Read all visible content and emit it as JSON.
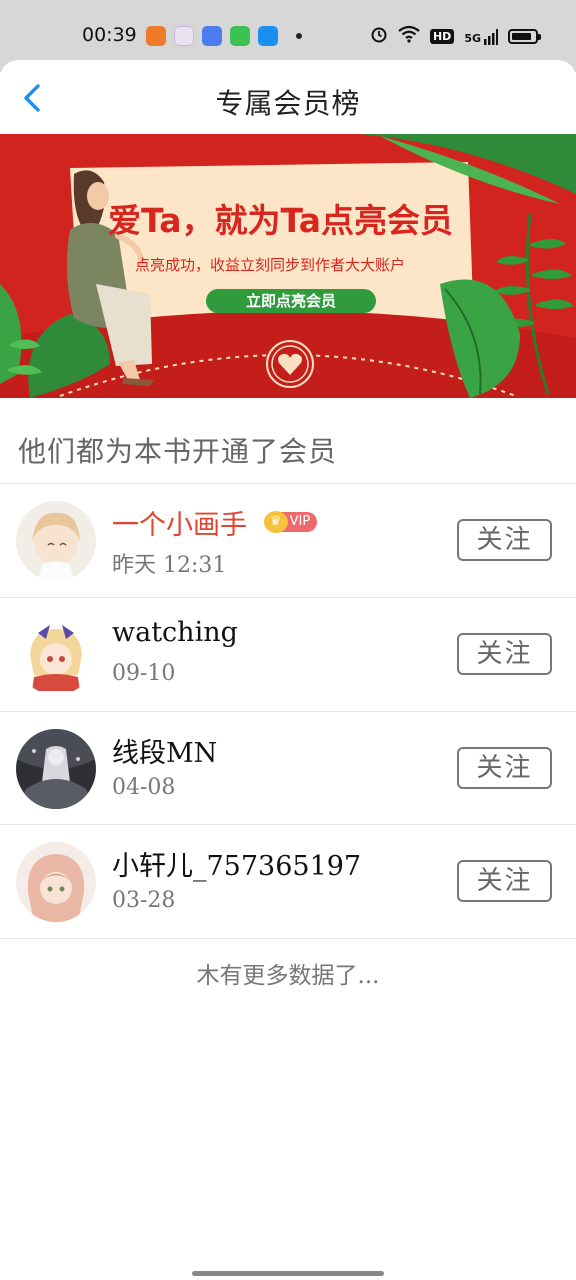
{
  "status_bar": {
    "time": "00:39",
    "app_icons": [
      {
        "name": "books-app-icon",
        "color": "#f07a2c"
      },
      {
        "name": "photos-app-icon",
        "color": "#e9e2ef"
      },
      {
        "name": "launcher-app-icon",
        "color": "#4b7cf0"
      },
      {
        "name": "wechat-store-app-icon",
        "color": "#3cc152"
      },
      {
        "name": "alipay-app-icon",
        "color": "#1b8ef2"
      }
    ],
    "hd_label": "HD",
    "network_label": "5G",
    "battery_level": 0.85
  },
  "header": {
    "title": "专属会员榜"
  },
  "banner": {
    "headline": "爱Ta，就为Ta点亮会员",
    "subline": "点亮成功，收益立刻同步到作者大大账户",
    "cta": "立即点亮会员"
  },
  "section": {
    "title": "他们都为本书开通了会员"
  },
  "members": [
    {
      "name": "一个小画手",
      "time": "昨天 12:31",
      "vip": true,
      "vip_label": "VIP",
      "follow_label": "关注"
    },
    {
      "name": "watching",
      "time": "09-10",
      "vip": false,
      "follow_label": "关注"
    },
    {
      "name": "线段MN",
      "time": "04-08",
      "vip": false,
      "follow_label": "关注"
    },
    {
      "name": "小轩儿_757365197",
      "time": "03-28",
      "vip": false,
      "follow_label": "关注"
    }
  ],
  "footer": {
    "no_more": "木有更多数据了..."
  },
  "colors": {
    "accent_blue": "#1e8ff0",
    "vip_name": "#e0452f",
    "banner_red": "#d2241f"
  }
}
